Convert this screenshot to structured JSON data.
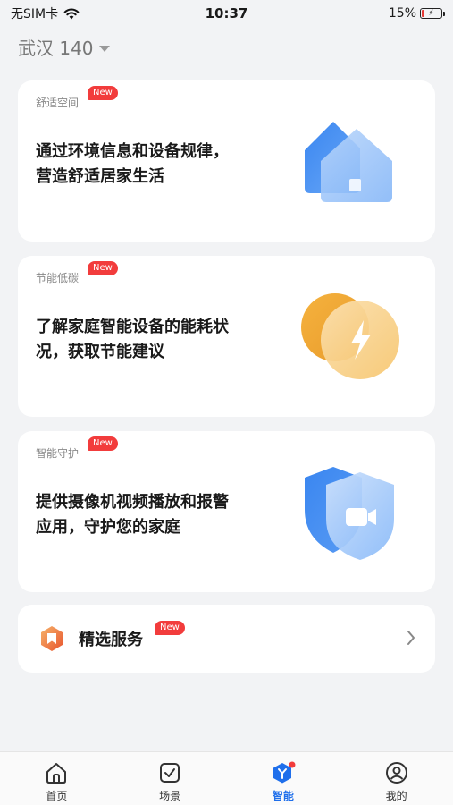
{
  "status_bar": {
    "carrier": "无SIM卡",
    "time": "10:37",
    "battery": "15%"
  },
  "home": {
    "title": "武汉 140"
  },
  "cards": [
    {
      "tag": "舒适空间",
      "badge": "New",
      "desc": "通过环境信息和设备规律，营造舒适居家生活"
    },
    {
      "tag": "节能低碳",
      "badge": "New",
      "desc": "了解家庭智能设备的能耗状况，获取节能建议"
    },
    {
      "tag": "智能守护",
      "badge": "New",
      "desc": "提供摄像机视频播放和报警应用，守护您的家庭"
    }
  ],
  "service": {
    "label": "精选服务",
    "badge": "New"
  },
  "tabs": [
    {
      "label": "首页"
    },
    {
      "label": "场景"
    },
    {
      "label": "智能"
    },
    {
      "label": "我的"
    }
  ],
  "colors": {
    "accent": "#1f6feb",
    "badge": "#f23c3c",
    "energy": "#f0a830"
  }
}
